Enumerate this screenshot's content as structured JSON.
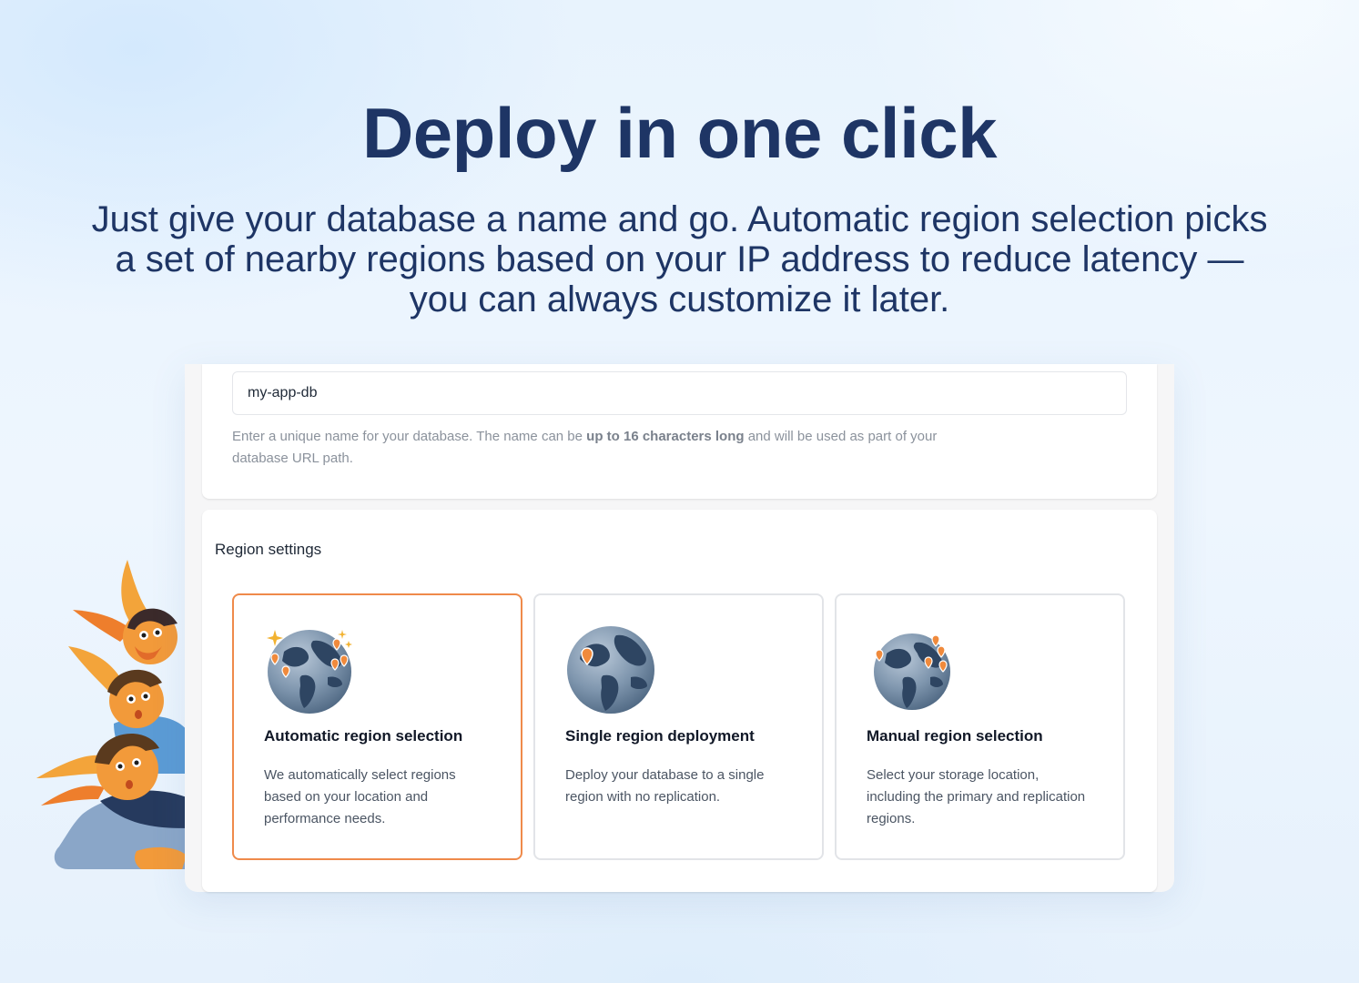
{
  "hero": {
    "title": "Deploy in one click",
    "subtitle": "Just give your database a name and go. Automatic region selection picks a set of nearby regions based on your IP address to reduce latency — you can always customize it later."
  },
  "database_name": {
    "value": "my-app-db",
    "help_before": "Enter a unique name for your database. The name can be ",
    "help_bold": "up to 16 characters long",
    "help_after": " and will be used as part of your database URL path."
  },
  "region_settings": {
    "label": "Region settings",
    "options": [
      {
        "title": "Automatic region selection",
        "description": "We automatically select regions based on your location and performance needs.",
        "icon": "globe-sparkle-icon",
        "selected": true
      },
      {
        "title": "Single region deployment",
        "description": "Deploy your database to a single region with no replication.",
        "icon": "globe-pin-icon",
        "selected": false
      },
      {
        "title": "Manual region selection",
        "description": "Select your storage location, including the primary and replication regions.",
        "icon": "globe-multi-pin-icon",
        "selected": false
      }
    ]
  },
  "colors": {
    "heading": "#1e3565",
    "selected_border": "#ef8a4a",
    "pin": "#f08a3c"
  }
}
